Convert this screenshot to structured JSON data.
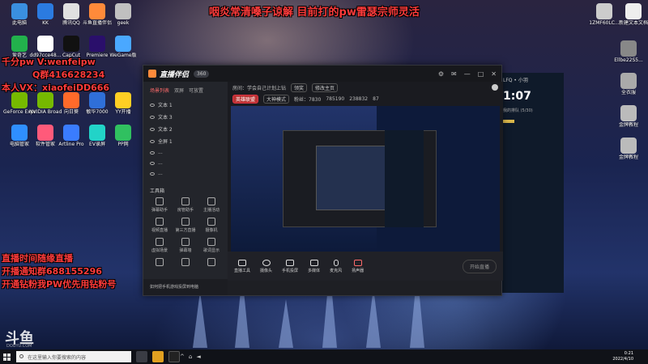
{
  "overlay": {
    "top_banner": "咽炎常清嗓子谅解 目前打的pw雷瑟宗师灵活",
    "left_lines": [
      "千分pw V:wenfeipw",
      "Q群416628234",
      "本人VX：xiaofeiDD666"
    ],
    "bottom_lines": [
      "直播时间随缘直播",
      "开播通知群688155296",
      "开通钻粉我PW优先用钻粉号"
    ]
  },
  "desktop_icons": [
    {
      "label": "此电脑",
      "color": "#3a8fe0"
    },
    {
      "label": "KK",
      "color": "#2b7be0"
    },
    {
      "label": "腾讯QQ",
      "color": "#e0e0e0"
    },
    {
      "label": "斗鱼直播伴侣",
      "color": "#ff8a3a"
    },
    {
      "label": "geek",
      "color": "#c0c0c0"
    },
    {
      "label": "爱奇艺",
      "color": "#22b14c"
    },
    {
      "label": "dd97cce48...",
      "color": "#ffffff"
    },
    {
      "label": "CapCut",
      "color": "#111111"
    },
    {
      "label": "Premiere",
      "color": "#2a0f6b"
    },
    {
      "label": "WeGame版",
      "color": "#4aa8ff"
    },
    {
      "label": "GeForce Experience",
      "color": "#76b900"
    },
    {
      "label": "NVIDIA Broadcast",
      "color": "#76b900"
    },
    {
      "label": "向日葵",
      "color": "#ff6a2a"
    },
    {
      "label": "敏华7000",
      "color": "#2f6fd8"
    },
    {
      "label": "YY开播",
      "color": "#ffcf24"
    },
    {
      "label": "电脑管家",
      "color": "#2f8fff"
    },
    {
      "label": "软件管家",
      "color": "#ff5a7a"
    },
    {
      "label": "Artline Pro",
      "color": "#3a7cff"
    },
    {
      "label": "EV录屏",
      "color": "#22d3c8"
    },
    {
      "label": "PP网",
      "color": "#30c060"
    }
  ],
  "right_icons": [
    {
      "label": "1ZMF60LC...",
      "color": "#cccccc"
    },
    {
      "label": "新建文本文档",
      "color": "#eeeeee"
    },
    {
      "label": "Ellbe22S5...",
      "color": "#888888"
    },
    {
      "label": "全衣服",
      "color": "#aaaaaa"
    },
    {
      "label": "金牌教程",
      "color": "#bbbbbb"
    },
    {
      "label": "金牌教程",
      "color": "#bbbbbb"
    }
  ],
  "app": {
    "logo": "直播伴侣",
    "version": "360",
    "sidebar_tabs": [
      "场景列表",
      "双屏",
      "可放置"
    ],
    "scenes": [
      "文本 1",
      "文本 3",
      "文本 2",
      "全屏 1",
      "...",
      "...",
      "..."
    ],
    "tools_title": "工具箱",
    "tools": [
      "弹幕助手",
      "房管助手",
      "主播活动",
      "视频直播",
      "第三方直播",
      "摄像机",
      "虚拟场景",
      "弹幕墙",
      "歌词显示",
      "",
      "",
      ""
    ],
    "status_text": "如何把手机游戏投屏到电脑",
    "room_title": "房间：学会自己计划上钻",
    "info_chips": [
      "领奖",
      "修改主页"
    ],
    "info_row2": [
      "英雄联盟",
      "大神模式",
      "粉丝：7830",
      "785190",
      "238832",
      "87"
    ],
    "bottom_buttons": [
      "直播工具",
      "摄像头",
      "手机投屏",
      "多媒体",
      "麦克风",
      "扬声器"
    ],
    "start_live": "开始直播"
  },
  "side_panel": {
    "header": "LFQ • 小羽",
    "timer": "1:07",
    "list_label": "我的排队 (5/30)"
  },
  "taskbar": {
    "search_placeholder": "在这里输入你要搜索的内容",
    "time": "0:21",
    "date": "2022/4/10"
  },
  "watermark": {
    "logo": "斗鱼",
    "sub": "DOUYU.COM"
  }
}
